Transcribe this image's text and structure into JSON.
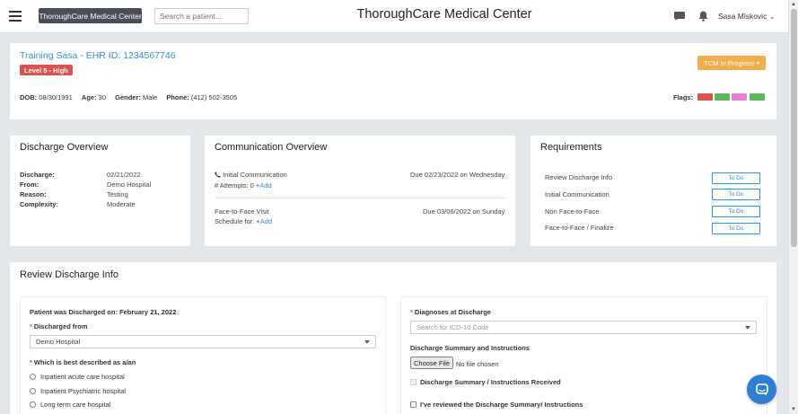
{
  "header": {
    "brand_label": "ThoroughCare Medical Center",
    "search_placeholder": "Search a patient...",
    "title": "ThoroughCare Medical Center",
    "user_name": "Sasa Miskovic"
  },
  "patient": {
    "name": "Training Sasa - EHR ID: 1234567746",
    "level": "Level 5 - High",
    "dob_label": "DOB:",
    "dob": "08/30/1991",
    "age_label": "Age:",
    "age": "30",
    "gender_label": "Gender:",
    "gender": "Male",
    "phone_label": "Phone:",
    "phone": "(412) 502-3505",
    "status_button": "TCM In Progress",
    "flags_label": "Flags:",
    "flag_colors": [
      "#d9534f",
      "#5cb85c",
      "#e87ecf",
      "#5cb85c"
    ]
  },
  "discharge_overview": {
    "title": "Discharge Overview",
    "rows": [
      {
        "label": "Discharge:",
        "value": "02/21/2022"
      },
      {
        "label": "From:",
        "value": "Demo Hospital"
      },
      {
        "label": "Reason:",
        "value": "Testing"
      },
      {
        "label": "Complexity:",
        "value": "Moderate"
      }
    ]
  },
  "communication_overview": {
    "title": "Communication Overview",
    "initial": {
      "label": "Initial Communication",
      "due": "Due 02/23/2022 on Wednesday",
      "attempts_label": "# Attempts: 0",
      "add_label": "Add"
    },
    "face": {
      "label": "Face-to-Face Visit",
      "due": "Due 03/06/2022 on Sunday",
      "schedule_label": "Schedule for:",
      "add_label": "Add"
    }
  },
  "requirements": {
    "title": "Requirements",
    "items": [
      {
        "label": "Review Discharge Info",
        "status": "To Do"
      },
      {
        "label": "Initial Communication",
        "status": "To Do"
      },
      {
        "label": "Non Face-to-Face",
        "status": "To Do"
      },
      {
        "label": "Face-to-Face / Finalize",
        "status": "To Do"
      }
    ]
  },
  "review": {
    "title": "Review Discharge Info",
    "discharged_on": "Patient was Discharged on: February 21, 2022",
    "discharged_from_label": "Discharged from",
    "discharged_from_value": "Demo Hospital",
    "described_label": "Which is best described as a/an",
    "options": [
      "Inpatient acute care hospital",
      "Inpatient Psychiatric hospital",
      "Long term care hospital"
    ],
    "diagnoses_label": "Diagnoses at Discharge",
    "icd_placeholder": "Search for ICD-10 Code",
    "summary_label": "Discharge Summary and Instructions",
    "choose_file": "Choose File",
    "no_file": "No file chosen",
    "received_label": "Discharge Summary / Instructions Received",
    "reviewed_label": "I've reviewed the Discharge Summary/ Instructions"
  }
}
